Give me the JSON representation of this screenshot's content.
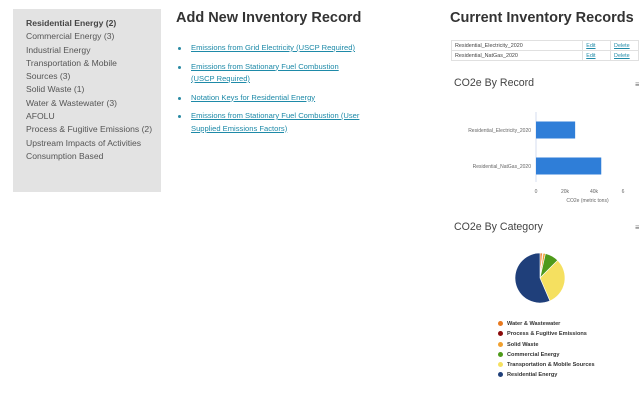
{
  "sidebar": {
    "items": [
      {
        "label": "Residential Energy (2)",
        "active": true
      },
      {
        "label": "Commercial Energy (3)",
        "active": false
      },
      {
        "label": "Industrial Energy",
        "active": false
      },
      {
        "label": "Transportation & Mobile",
        "active": false
      },
      {
        "label": "Sources (3)",
        "active": false
      },
      {
        "label": "Solid Waste (1)",
        "active": false
      },
      {
        "label": "Water & Wastewater (3)",
        "active": false
      },
      {
        "label": "AFOLU",
        "active": false
      },
      {
        "label": "Process & Fugitive Emissions (2)",
        "active": false
      },
      {
        "label": "Upstream Impacts of Activities",
        "active": false
      },
      {
        "label": "Consumption Based",
        "active": false
      }
    ]
  },
  "add_record": {
    "title": "Add New Inventory Record",
    "links": [
      {
        "line1": "Emissions from Grid Electricity (USCP Required)",
        "line2": ""
      },
      {
        "line1": "Emissions from Stationary Fuel Combustion",
        "line2": "(USCP Required)"
      },
      {
        "line1": "Notation Keys for Residential Energy",
        "line2": ""
      },
      {
        "line1": "Emissions from Stationary Fuel Combustion (User",
        "line2": "Supplied Emissions Factors)"
      }
    ]
  },
  "current": {
    "title": "Current Inventory Records",
    "records": [
      {
        "name": "Residential_Electricity_2020",
        "edit": "Edit",
        "delete": "Delete"
      },
      {
        "name": "Residential_NatGas_2020",
        "edit": "Edit",
        "delete": "Delete"
      }
    ]
  },
  "menu_icon": "≡",
  "chart_data": [
    {
      "type": "bar",
      "orientation": "horizontal",
      "title": "CO2e By Record",
      "categories": [
        "Residential_Electricity_2020",
        "Residential_NatGas_2020"
      ],
      "values": [
        27000,
        45000
      ],
      "xlabel": "CO2e (metric tons)",
      "xlim": [
        0,
        60000
      ],
      "tick_labels": [
        "0",
        "20k",
        "40k",
        "6"
      ],
      "bar_color": "#2f7ed8",
      "grid": false
    },
    {
      "type": "pie",
      "title": "CO2e By Category",
      "categories": [
        "Water & Wastewater",
        "Process & Fugitive Emissions",
        "Solid Waste",
        "Commercial Energy",
        "Transportation & Mobile Sources",
        "Residential Energy"
      ],
      "values": [
        1.5,
        0.5,
        1.5,
        9,
        31,
        56.5
      ],
      "colors": [
        "#e8791f",
        "#8b0a0a",
        "#f0a030",
        "#4e9a1a",
        "#f5e060",
        "#1f3f7a"
      ],
      "legend_position": "bottom"
    }
  ]
}
